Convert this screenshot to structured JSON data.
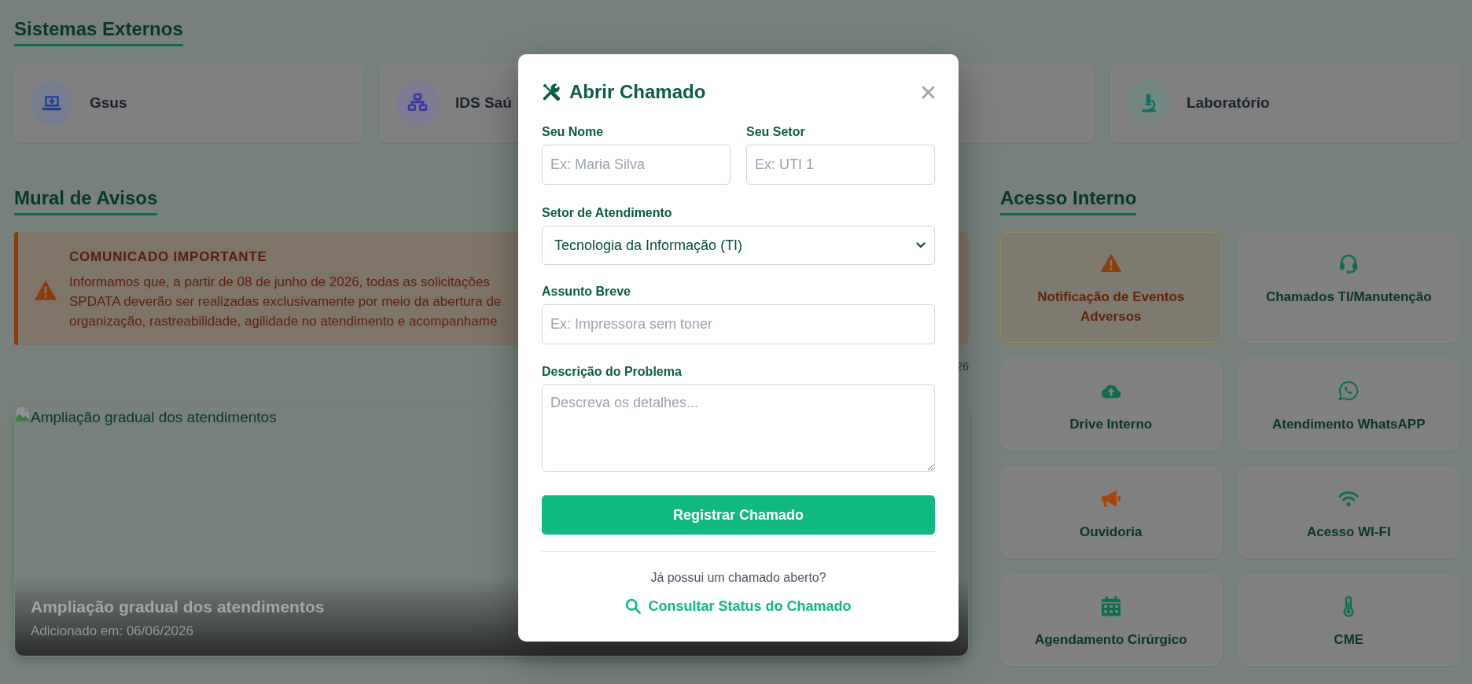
{
  "external_systems": {
    "title": "Sistemas Externos",
    "items": [
      {
        "kind": "system",
        "label": "Gsus",
        "color": "#1e3f94"
      },
      {
        "kind": "system",
        "label": "IDS Saú",
        "color": "#3b35a6"
      },
      {
        "kind": "covered"
      },
      {
        "kind": "system",
        "label": "Laboratório",
        "color": "#12705c"
      }
    ]
  },
  "notice_board": {
    "title": "Mural de Avisos",
    "notice": {
      "title": "COMUNICADO IMPORTANTE",
      "text": "Informamos que, a partir de 08 de junho de 2026, todas as solicitações\nSPDATA deverão ser realizadas exclusivamente por meio da abertura de\norganização, rastreabilidade, agilidade no atendimento e acompanhame",
      "meta": "26"
    },
    "news": {
      "image_alt": "Ampliação gradual dos atendimentos",
      "title": "Ampliação gradual dos atendimentos",
      "added": "Adicionado em: 06/06/2026"
    }
  },
  "internal_access": {
    "title": "Acesso Interno",
    "tiles": [
      {
        "label": "Notificação de Eventos Adversos",
        "kind": "alert",
        "color": "#8b3f09"
      },
      {
        "label": "Chamados TI/Manutenção",
        "kind": "link",
        "color": "#0e6e4c"
      },
      {
        "label": "Drive Interno",
        "kind": "link",
        "color": "#0e6e4c"
      },
      {
        "label": "Atendimento WhatsAPP",
        "kind": "link",
        "color": "#0e6e4c"
      },
      {
        "label": "Ouvidoria",
        "kind": "link",
        "color": "#a3470f"
      },
      {
        "label": "Acesso WI-FI",
        "kind": "link",
        "color": "#0e6e4c"
      },
      {
        "label": "Agendamento Cirúrgico",
        "kind": "link",
        "color": "#0e6e4c"
      },
      {
        "label": "CME",
        "kind": "link",
        "color": "#0e6e4c"
      }
    ]
  },
  "modal": {
    "title": "Abrir Chamado",
    "rows": [
      {
        "fields": [
          {
            "kind": "input",
            "label": "Seu Nome",
            "placeholder": "Ex: Maria Silva"
          },
          {
            "kind": "input",
            "label": "Seu Setor",
            "placeholder": "Ex: UTI 1"
          }
        ]
      },
      {
        "fields": [
          {
            "kind": "select",
            "label": "Setor de Atendimento",
            "value": "Tecnologia da Informação (TI)"
          }
        ]
      },
      {
        "fields": [
          {
            "kind": "input",
            "label": "Assunto Breve",
            "placeholder": "Ex: Impressora sem toner"
          }
        ]
      },
      {
        "fields": [
          {
            "kind": "textarea",
            "label": "Descrição do Problema",
            "placeholder": "Descreva os detalhes..."
          }
        ]
      }
    ],
    "submit": "Registrar Chamado",
    "question": "Já possui um chamado aberto?",
    "status_link": "Consultar Status do Chamado"
  }
}
